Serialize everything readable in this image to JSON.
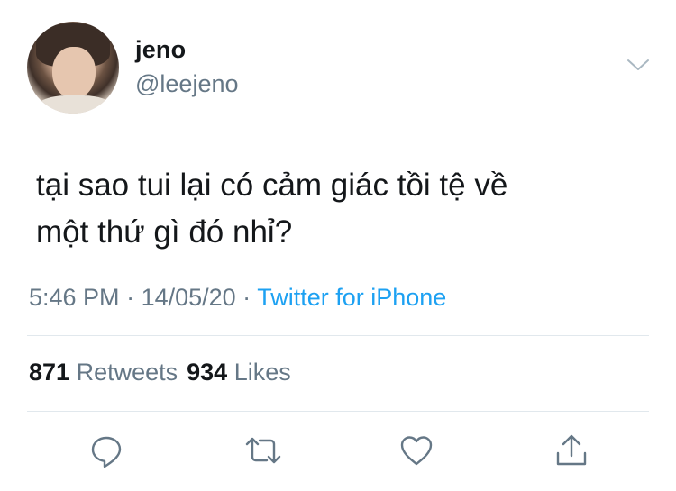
{
  "user": {
    "name": "jeno",
    "handle": "@leejeno"
  },
  "tweet": {
    "text_line1": "tại sao tui lại có cảm giác tồi tệ về",
    "text_line2": "một thứ gì đó nhỉ?"
  },
  "meta": {
    "time": "5:46 PM",
    "sep1": " · ",
    "date": "14/05/20",
    "sep2": " · ",
    "source": "Twitter for iPhone"
  },
  "stats": {
    "retweets_count": "871",
    "retweets_label": "Retweets",
    "likes_count": "934",
    "likes_label": "Likes"
  },
  "icons": {
    "menu": "chevron-down-icon",
    "reply": "reply-icon",
    "retweet": "retweet-icon",
    "like": "heart-icon",
    "share": "share-icon"
  },
  "colors": {
    "text": "#14171a",
    "secondary": "#657786",
    "link": "#1da1f2",
    "divider": "#e1e8ed"
  }
}
